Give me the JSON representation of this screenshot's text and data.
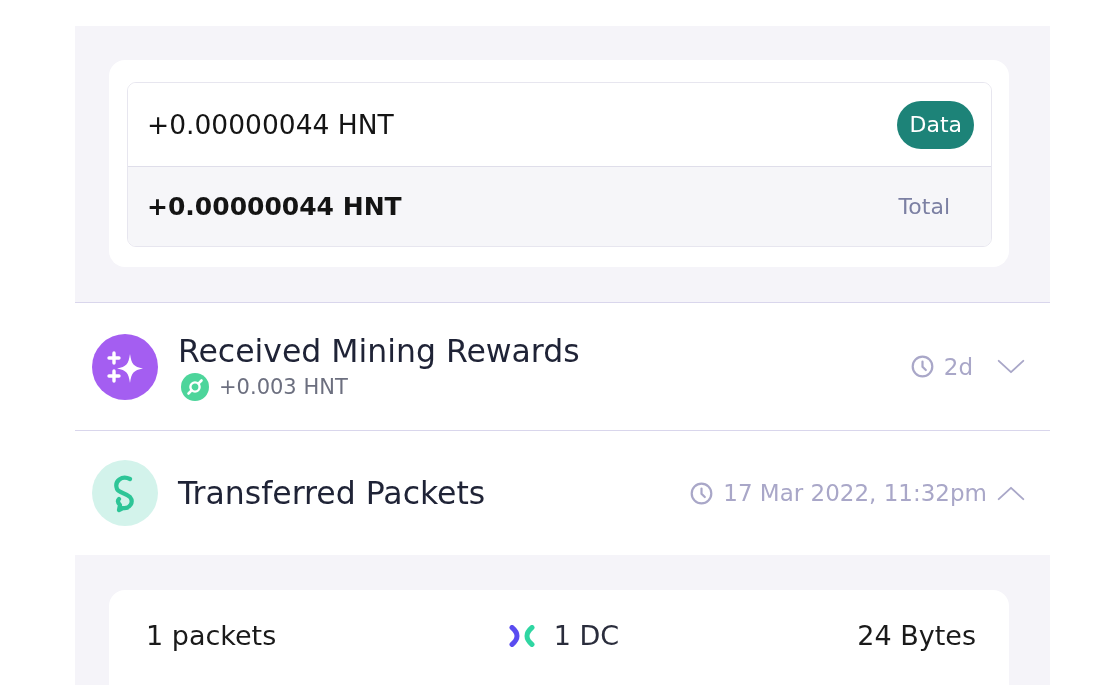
{
  "reward_breakdown": {
    "rows": [
      {
        "kind": "item",
        "amount": "+0.00000044 HNT",
        "tag": "Data"
      },
      {
        "kind": "total",
        "amount": "+0.00000044 HNT",
        "label": "Total"
      }
    ]
  },
  "activities": [
    {
      "kind": "mining_rewards",
      "title": "Received Mining Rewards",
      "subtitle": "+0.003 HNT",
      "time": "2d",
      "expanded": false
    },
    {
      "kind": "packets",
      "title": "Transferred Packets",
      "time": "17 Mar 2022, 11:32pm",
      "expanded": true,
      "details": {
        "packets": "1 packets",
        "dc": "1 DC",
        "bytes": "24 Bytes"
      }
    }
  ]
}
